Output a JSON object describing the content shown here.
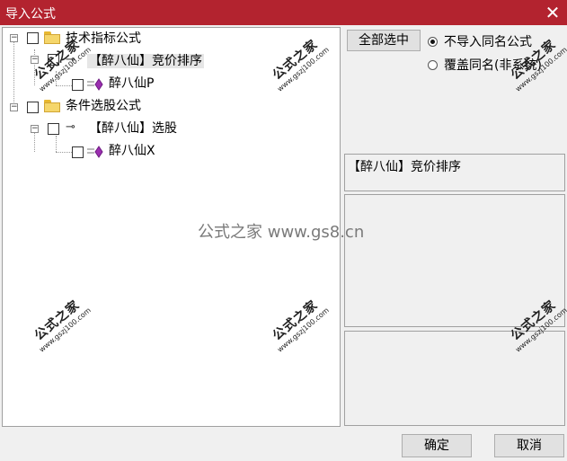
{
  "window": {
    "title": "导入公式",
    "close_icon": "close-icon"
  },
  "tree": {
    "items": [
      {
        "label": "技术指标公式",
        "icon": "folder-icon",
        "level": 0
      },
      {
        "label": "【醉八仙】竞价排序",
        "icon": "key-icon",
        "level": 1
      },
      {
        "label": "醉八仙P",
        "icon": "gem-icon",
        "level": 2
      },
      {
        "label": "条件选股公式",
        "icon": "folder-icon",
        "level": 0
      },
      {
        "label": "【醉八仙】选股",
        "icon": "key-icon",
        "level": 1
      },
      {
        "label": "醉八仙X",
        "icon": "gem-icon",
        "level": 2
      }
    ]
  },
  "options": {
    "select_all_label": "全部选中",
    "radio_no_import_label": "不导入同名公式",
    "radio_overwrite_label": "覆盖同名(非系统)",
    "selected_radio": "不导入同名公式"
  },
  "info": {
    "formula_name": "【醉八仙】竞价排序"
  },
  "footer": {
    "ok_label": "确定",
    "cancel_label": "取消"
  },
  "watermark": {
    "center_text": "公式之家 www.gs8.cn",
    "stamp_text": "公式之家",
    "stamp_url": "www.gszj100.com"
  },
  "colors": {
    "titlebar": "#b3232f",
    "gem": "#9b2fb0"
  }
}
